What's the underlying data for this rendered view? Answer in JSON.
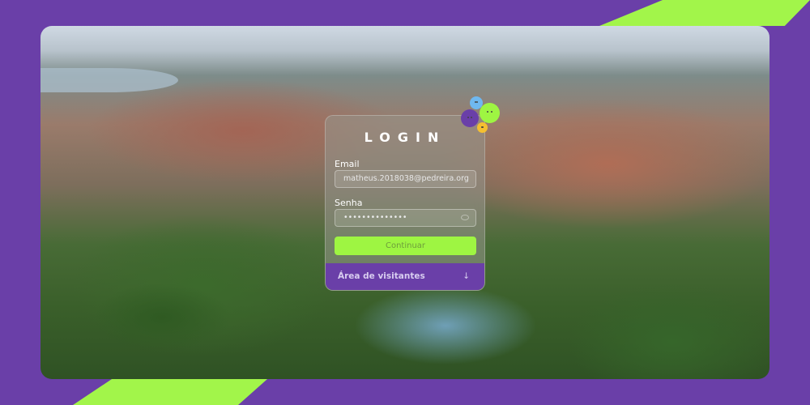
{
  "login": {
    "title": "LOGIN",
    "email_label": "Email",
    "email_value": "matheus.2018038@pedreira.org",
    "password_label": "Senha",
    "password_value": "••••••••••••••",
    "submit": "Continuar",
    "visitors": "Área de visitantes",
    "visitors_icon": "↓"
  },
  "colors": {
    "accent": "#9ef542",
    "purple": "#6a3fa8"
  }
}
